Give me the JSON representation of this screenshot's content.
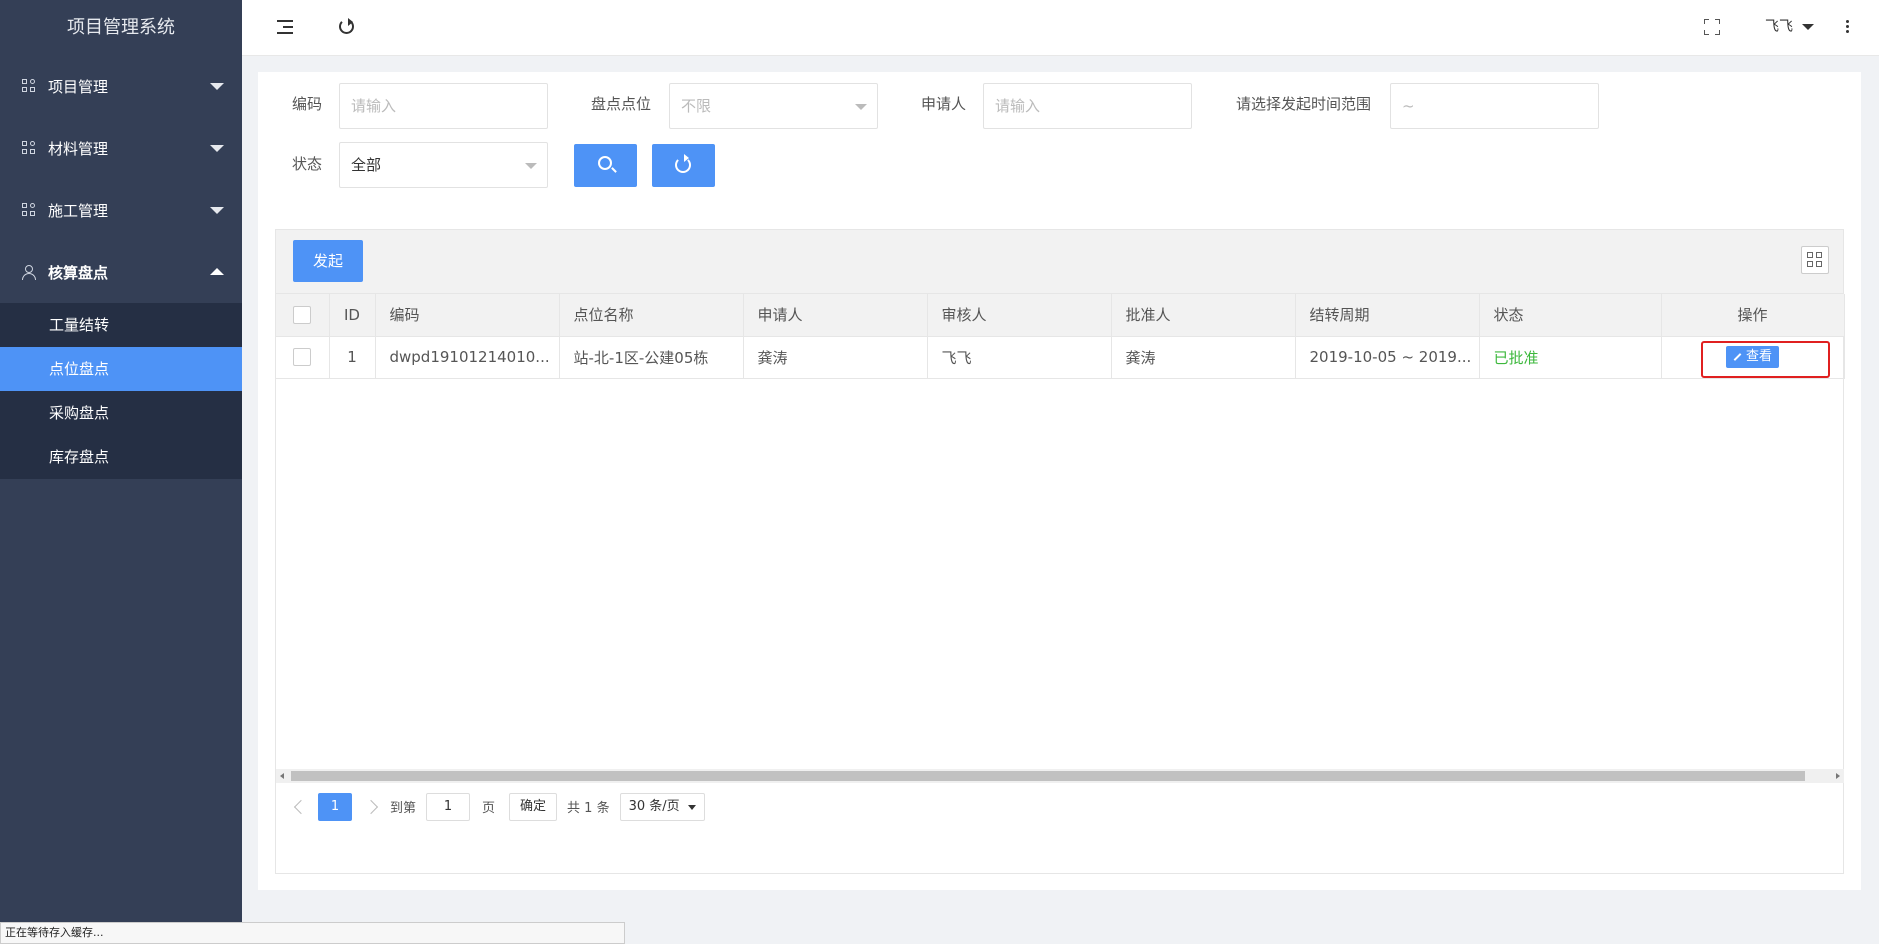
{
  "app": {
    "title": "项目管理系统"
  },
  "sidebar": {
    "groups": [
      {
        "label": "项目管理"
      },
      {
        "label": "材料管理"
      },
      {
        "label": "施工管理"
      },
      {
        "label": "核算盘点"
      }
    ],
    "subitems": [
      {
        "label": "工量结转"
      },
      {
        "label": "点位盘点"
      },
      {
        "label": "采购盘点"
      },
      {
        "label": "库存盘点"
      }
    ]
  },
  "header": {
    "user": "飞飞"
  },
  "filters": {
    "code_label": "编码",
    "code_placeholder": "请输入",
    "location_label": "盘点点位",
    "location_value": "不限",
    "applicant_label": "申请人",
    "applicant_placeholder": "请输入",
    "date_label": "请选择发起时间范围",
    "date_value": "~",
    "status_label": "状态",
    "status_value": "全部"
  },
  "toolbar": {
    "launch_label": "发起"
  },
  "table": {
    "headers": [
      "ID",
      "编码",
      "点位名称",
      "申请人",
      "审核人",
      "批准人",
      "结转周期",
      "状态",
      "操作"
    ],
    "rows": [
      {
        "id": "1",
        "code": "dwpd19101214010...",
        "location": "站-北-1区-公建05栋",
        "applicant": "龚涛",
        "reviewer": "飞飞",
        "approver": "龚涛",
        "period": "2019-10-05 ~ 2019...",
        "status": "已批准",
        "action": "查看"
      }
    ]
  },
  "pager": {
    "current": "1",
    "goto_label": "到第",
    "page_input": "1",
    "page_unit": "页",
    "ok_label": "确定",
    "total": "共 1 条",
    "size": "30 条/页"
  },
  "statusbar": {
    "text": "正在等待存入缓存..."
  },
  "colors": {
    "accent": "#4e93f6",
    "sidebar": "#343f56",
    "approved": "#3db83d",
    "highlight": "#e02020"
  }
}
